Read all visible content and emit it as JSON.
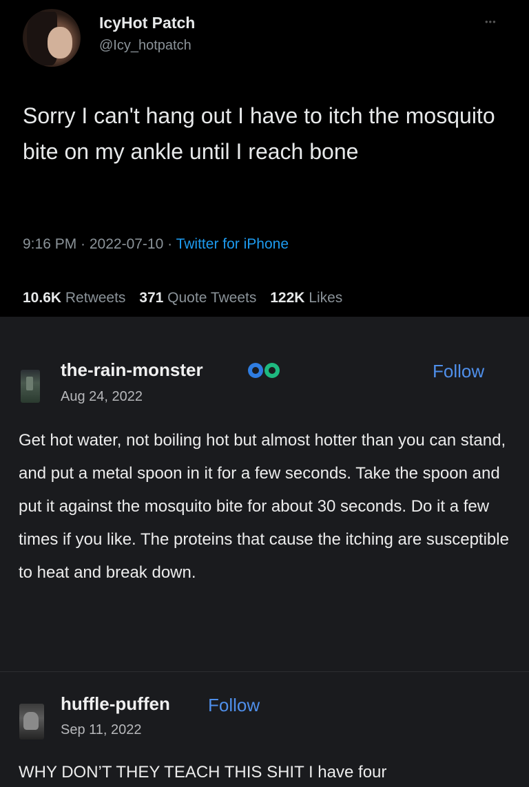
{
  "tweet": {
    "display_name": "IcyHot Patch",
    "handle": "@Icy_hotpatch",
    "more_icon": "more-dots-icon",
    "text": "Sorry I can't hang out I have to itch the mosquito bite on my ankle until I reach bone",
    "time": "9:16 PM · 2022-07-10 ·",
    "source": "Twitter for iPhone",
    "retweets_count": "10.6K",
    "retweets_label": "Retweets",
    "quotes_count": "371",
    "quotes_label": "Quote Tweets",
    "likes_count": "122K",
    "likes_label": "Likes"
  },
  "tumblr": {
    "posts": [
      {
        "blog_name": "the-rain-monster",
        "follow_label": "Follow",
        "date": "Aug 24, 2022",
        "badges": [
          "verified-blue-icon",
          "verified-green-icon"
        ],
        "text": "Get hot water, not boiling hot but almost hotter than you can stand, and put a metal spoon in it for a few seconds. Take the spoon and put it against the mosquito bite for about 30 seconds. Do it a few times if you like. The proteins that cause the itching are susceptible to heat and break down."
      },
      {
        "blog_name": "huffle-puffen",
        "follow_label": "Follow",
        "date": "Sep 11, 2022",
        "text": "WHY DON’T THEY TEACH THIS SHIT I have four"
      }
    ]
  },
  "colors": {
    "twitter_bg": "#000000",
    "tumblr_bg": "#1a1b1e",
    "link_blue": "#1d9bf0",
    "follow_blue": "#4f8fea",
    "secondary_text": "#8b9399"
  }
}
